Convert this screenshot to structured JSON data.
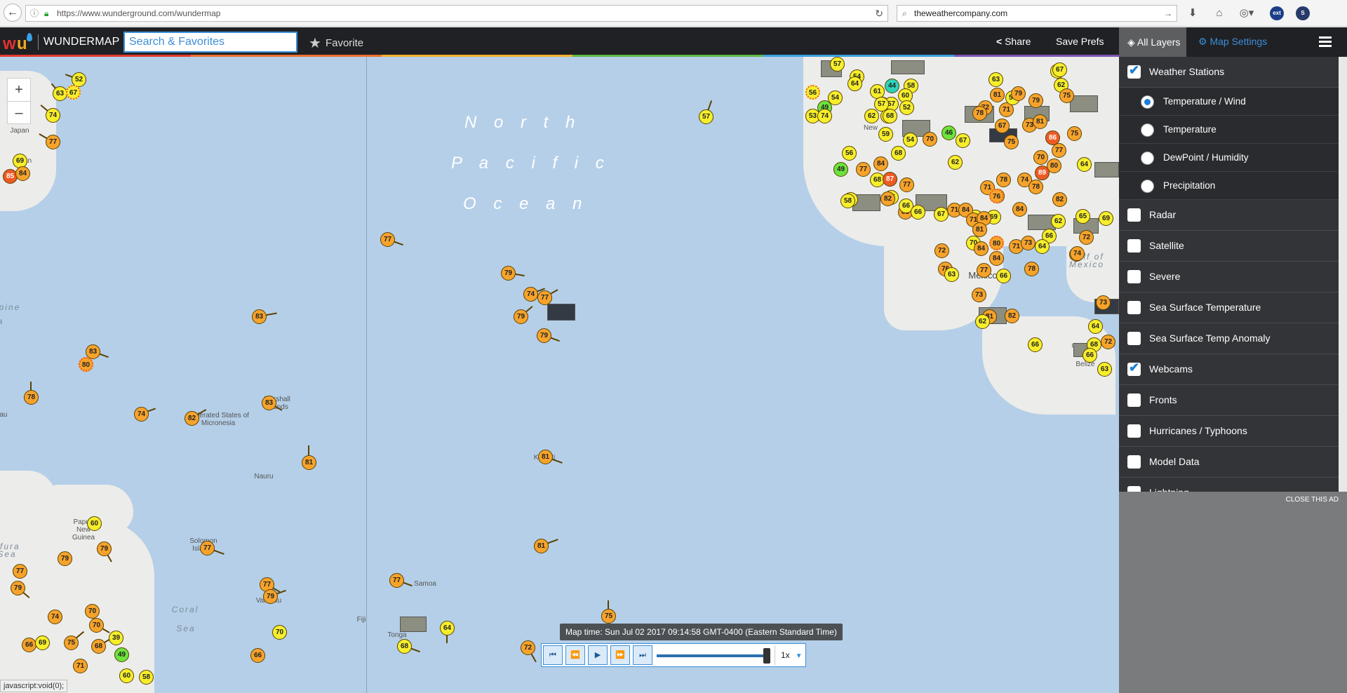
{
  "browser": {
    "url": "https://www.wunderground.com/wundermap",
    "search_value": "theweathercompany.com",
    "back_icon": "arrow-left-icon",
    "reload_icon": "reload-icon"
  },
  "header": {
    "brand": "WUNDERMAP",
    "search_placeholder": "Search & Favorites",
    "favorite_label": "Favorite",
    "share_label": "Share",
    "save_prefs_label": "Save Prefs",
    "all_layers_label": "All Layers",
    "map_settings_label": "Map Settings",
    "accent_color": "#3c8fd8"
  },
  "map": {
    "ocean_label": [
      "N o r t h",
      "P a c i f i c",
      "O c e a n"
    ],
    "places": [
      {
        "text": "Japan",
        "cls": ""
      },
      {
        "text": "apan",
        "cls": ""
      },
      {
        "text": "pine",
        "cls": "ital"
      },
      {
        "text": "a",
        "cls": "ital"
      },
      {
        "text": "alau",
        "cls": ""
      },
      {
        "text": "Federated States of Micronesia",
        "cls": ""
      },
      {
        "text": "Marshall Islands",
        "cls": ""
      },
      {
        "text": "Nauru",
        "cls": ""
      },
      {
        "text": "Papua New Guinea",
        "cls": ""
      },
      {
        "text": "afura Sea",
        "cls": "ital"
      },
      {
        "text": "Solomon Islands",
        "cls": ""
      },
      {
        "text": "Coral",
        "cls": "ital"
      },
      {
        "text": "Sea",
        "cls": "ital"
      },
      {
        "text": "Vanuatu",
        "cls": ""
      },
      {
        "text": "Fiji",
        "cls": ""
      },
      {
        "text": "Samoa",
        "cls": ""
      },
      {
        "text": "Tonga",
        "cls": ""
      },
      {
        "text": "Kiribati",
        "cls": ""
      },
      {
        "text": "New",
        "cls": ""
      },
      {
        "text": "Mexico",
        "cls": "big"
      },
      {
        "text": "Gulf of Mexico",
        "cls": "ital"
      },
      {
        "text": "Gua",
        "cls": ""
      },
      {
        "text": "Belize",
        "cls": ""
      }
    ],
    "stations": [
      {
        "v": "52",
        "c": "y"
      },
      {
        "v": "63",
        "c": "y"
      },
      {
        "v": "67",
        "c": "y",
        "d": true
      },
      {
        "v": "74",
        "c": "y"
      },
      {
        "v": "77",
        "c": "o"
      },
      {
        "v": "69",
        "c": "y"
      },
      {
        "v": "85",
        "c": "r"
      },
      {
        "v": "84",
        "c": "o"
      },
      {
        "v": "83",
        "c": "o"
      },
      {
        "v": "83",
        "c": "o"
      },
      {
        "v": "80",
        "c": "o",
        "d": true
      },
      {
        "v": "78",
        "c": "o"
      },
      {
        "v": "74",
        "c": "o"
      },
      {
        "v": "82",
        "c": "o"
      },
      {
        "v": "83",
        "c": "o"
      },
      {
        "v": "81",
        "c": "o"
      },
      {
        "v": "60",
        "c": "y"
      },
      {
        "v": "79",
        "c": "o"
      },
      {
        "v": "79",
        "c": "o"
      },
      {
        "v": "77",
        "c": "o"
      },
      {
        "v": "77",
        "c": "o"
      },
      {
        "v": "79",
        "c": "o"
      },
      {
        "v": "79",
        "c": "o"
      },
      {
        "v": "77",
        "c": "o"
      },
      {
        "v": "74",
        "c": "o"
      },
      {
        "v": "70",
        "c": "o"
      },
      {
        "v": "70",
        "c": "o"
      },
      {
        "v": "75",
        "c": "o"
      },
      {
        "v": "39",
        "c": "y"
      },
      {
        "v": "68",
        "c": "o"
      },
      {
        "v": "66",
        "c": "o"
      },
      {
        "v": "69",
        "c": "y"
      },
      {
        "v": "49",
        "c": "g"
      },
      {
        "v": "71",
        "c": "o"
      },
      {
        "v": "60",
        "c": "y"
      },
      {
        "v": "58",
        "c": "y"
      },
      {
        "v": "70",
        "c": "y"
      },
      {
        "v": "66",
        "c": "o"
      },
      {
        "v": "77",
        "c": "o"
      },
      {
        "v": "79",
        "c": "o"
      },
      {
        "v": "74",
        "c": "o"
      },
      {
        "v": "77",
        "c": "o"
      },
      {
        "v": "79",
        "c": "o"
      },
      {
        "v": "79",
        "c": "o"
      },
      {
        "v": "81",
        "c": "o"
      },
      {
        "v": "81",
        "c": "o"
      },
      {
        "v": "77",
        "c": "o"
      },
      {
        "v": "68",
        "c": "y"
      },
      {
        "v": "64",
        "c": "y"
      },
      {
        "v": "72",
        "c": "o"
      },
      {
        "v": "75",
        "c": "o"
      },
      {
        "v": "57",
        "c": "y"
      },
      {
        "v": "57",
        "c": "y"
      },
      {
        "v": "54",
        "c": "y"
      },
      {
        "v": "56",
        "c": "y",
        "d": true
      },
      {
        "v": "53",
        "c": "y"
      },
      {
        "v": "49",
        "c": "g"
      },
      {
        "v": "54",
        "c": "y"
      },
      {
        "v": "74",
        "c": "y"
      },
      {
        "v": "64",
        "c": "y"
      },
      {
        "v": "44",
        "c": "t"
      },
      {
        "v": "61",
        "c": "y"
      },
      {
        "v": "57",
        "c": "y"
      },
      {
        "v": "58",
        "c": "y"
      },
      {
        "v": "60",
        "c": "y"
      },
      {
        "v": "57",
        "c": "y"
      },
      {
        "v": "52",
        "c": "y"
      },
      {
        "v": "64",
        "c": "y"
      },
      {
        "v": "57",
        "c": "y"
      },
      {
        "v": "62",
        "c": "y"
      },
      {
        "v": "68",
        "c": "y"
      },
      {
        "v": "46",
        "c": "g"
      },
      {
        "v": "67",
        "c": "y"
      },
      {
        "v": "71",
        "c": "o"
      },
      {
        "v": "72",
        "c": "o"
      },
      {
        "v": "59",
        "c": "y"
      },
      {
        "v": "54",
        "c": "y"
      },
      {
        "v": "56",
        "c": "y"
      },
      {
        "v": "68",
        "c": "y"
      },
      {
        "v": "62",
        "c": "y"
      },
      {
        "v": "49",
        "c": "g"
      },
      {
        "v": "77",
        "c": "o"
      },
      {
        "v": "84",
        "c": "o"
      },
      {
        "v": "68",
        "c": "y"
      },
      {
        "v": "87",
        "c": "r"
      },
      {
        "v": "77",
        "c": "o"
      },
      {
        "v": "65",
        "c": "y"
      },
      {
        "v": "58",
        "c": "y"
      },
      {
        "v": "58",
        "c": "y"
      },
      {
        "v": "82",
        "c": "o"
      },
      {
        "v": "83",
        "c": "o"
      },
      {
        "v": "66",
        "c": "y"
      },
      {
        "v": "66",
        "c": "y"
      },
      {
        "v": "67",
        "c": "y"
      },
      {
        "v": "71",
        "c": "o"
      },
      {
        "v": "70",
        "c": "y"
      },
      {
        "v": "71",
        "c": "o"
      },
      {
        "v": "84",
        "c": "o"
      },
      {
        "v": "71",
        "c": "o"
      },
      {
        "v": "69",
        "c": "y"
      },
      {
        "v": "84",
        "c": "o"
      },
      {
        "v": "81",
        "c": "o"
      },
      {
        "v": "80",
        "c": "o",
        "d": true
      },
      {
        "v": "70",
        "c": "y"
      },
      {
        "v": "77",
        "c": "o"
      },
      {
        "v": "76",
        "c": "o"
      },
      {
        "v": "78",
        "c": "o"
      },
      {
        "v": "84",
        "c": "o"
      },
      {
        "v": "84",
        "c": "o"
      },
      {
        "v": "63",
        "c": "y"
      },
      {
        "v": "66",
        "c": "y"
      },
      {
        "v": "71",
        "c": "o"
      },
      {
        "v": "73",
        "c": "o"
      },
      {
        "v": "72",
        "c": "o"
      },
      {
        "v": "74",
        "c": "o"
      },
      {
        "v": "70",
        "c": "o"
      },
      {
        "v": "67",
        "c": "o"
      },
      {
        "v": "73",
        "c": "o"
      },
      {
        "v": "75",
        "c": "o"
      },
      {
        "v": "77",
        "c": "o"
      },
      {
        "v": "70",
        "c": "o"
      },
      {
        "v": "80",
        "c": "o"
      },
      {
        "v": "78",
        "c": "o"
      },
      {
        "v": "76",
        "c": "o",
        "d": true
      },
      {
        "v": "74",
        "c": "o"
      },
      {
        "v": "78",
        "c": "o"
      },
      {
        "v": "89",
        "c": "r"
      },
      {
        "v": "84",
        "c": "o"
      },
      {
        "v": "82",
        "c": "o"
      },
      {
        "v": "66",
        "c": "y"
      },
      {
        "v": "64",
        "c": "y"
      },
      {
        "v": "62",
        "c": "y"
      },
      {
        "v": "65",
        "c": "y"
      },
      {
        "v": "69",
        "c": "y"
      },
      {
        "v": "72",
        "c": "o"
      },
      {
        "v": "73",
        "c": "o"
      },
      {
        "v": "74",
        "c": "o"
      },
      {
        "v": "78",
        "c": "o"
      },
      {
        "v": "81",
        "c": "o"
      },
      {
        "v": "63",
        "c": "y"
      },
      {
        "v": "57",
        "c": "y"
      },
      {
        "v": "79",
        "c": "o"
      },
      {
        "v": "79",
        "c": "o"
      },
      {
        "v": "81",
        "c": "o"
      },
      {
        "v": "86",
        "c": "r"
      },
      {
        "v": "75",
        "c": "o"
      },
      {
        "v": "64",
        "c": "y"
      },
      {
        "v": "73",
        "c": "o"
      },
      {
        "v": "81",
        "c": "o"
      },
      {
        "v": "82",
        "c": "o"
      },
      {
        "v": "62",
        "c": "y"
      },
      {
        "v": "66",
        "c": "y"
      },
      {
        "v": "64",
        "c": "y"
      },
      {
        "v": "73",
        "c": "o"
      },
      {
        "v": "68",
        "c": "y"
      },
      {
        "v": "66",
        "c": "y"
      },
      {
        "v": "63",
        "c": "y"
      },
      {
        "v": "72",
        "c": "o"
      },
      {
        "v": "69",
        "c": "y"
      },
      {
        "v": "62",
        "c": "y"
      },
      {
        "v": "67",
        "c": "y"
      },
      {
        "v": "75",
        "c": "o"
      }
    ],
    "zoom_in": "+",
    "zoom_out": "–",
    "timestamp": "Map time: Sun Jul 02 2017 09:14:58 GMT-0400 (Eastern Standard Time)",
    "speed": "1x",
    "status": "javascript:void(0);"
  },
  "layers": {
    "items": [
      {
        "label": "Weather Stations",
        "checked": true
      },
      {
        "label": "Radar",
        "checked": false
      },
      {
        "label": "Satellite",
        "checked": false
      },
      {
        "label": "Severe",
        "checked": false
      },
      {
        "label": "Sea Surface Temperature",
        "checked": false
      },
      {
        "label": "Sea Surface Temp Anomaly",
        "checked": false
      },
      {
        "label": "Webcams",
        "checked": true
      },
      {
        "label": "Fronts",
        "checked": false
      },
      {
        "label": "Hurricanes / Typhoons",
        "checked": false
      },
      {
        "label": "Model Data",
        "checked": false
      },
      {
        "label": "Lightning",
        "checked": false
      }
    ],
    "station_modes": [
      {
        "label": "Temperature / Wind",
        "selected": true
      },
      {
        "label": "Temperature",
        "selected": false
      },
      {
        "label": "DewPoint / Humidity",
        "selected": false
      },
      {
        "label": "Precipitation",
        "selected": false
      }
    ]
  },
  "ad": {
    "close_label": "CLOSE THIS AD"
  }
}
